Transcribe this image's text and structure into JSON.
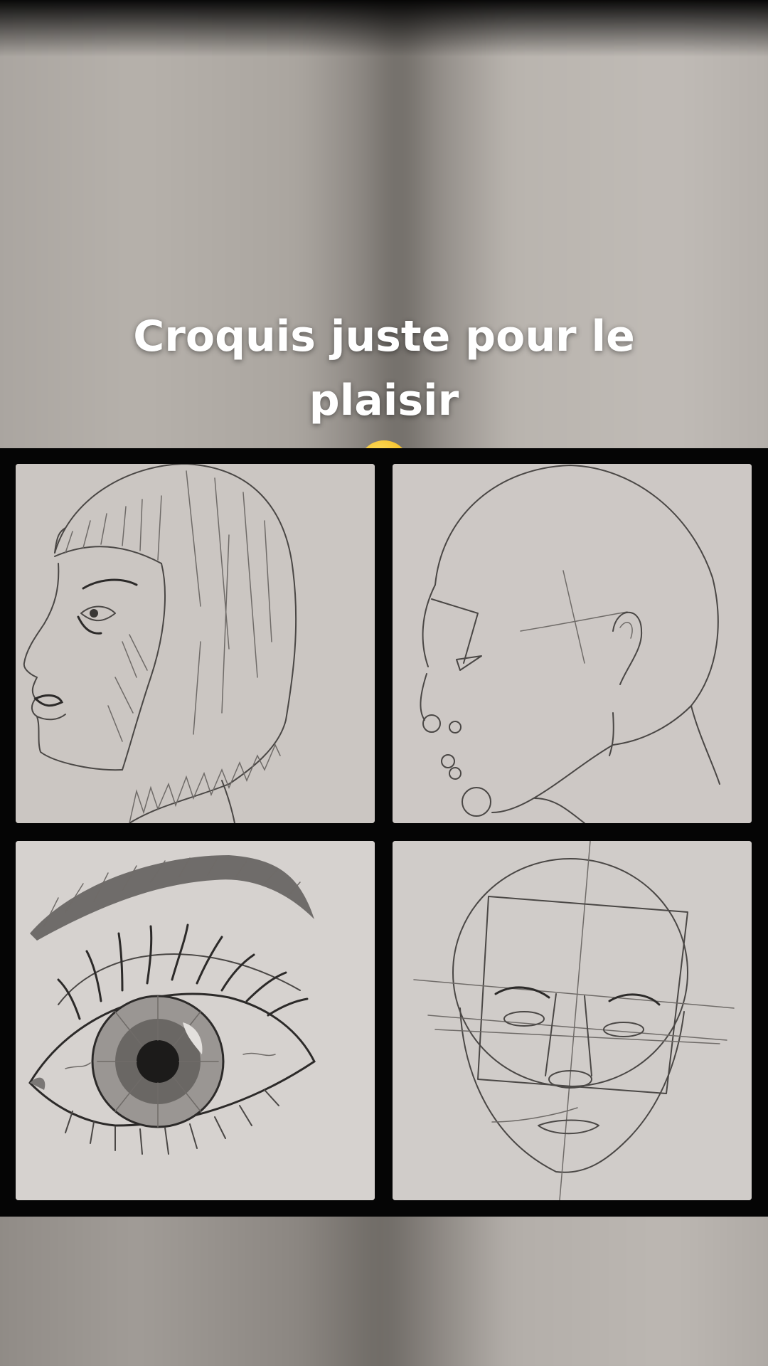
{
  "story": {
    "caption": "Croquis juste pour le plaisir",
    "caption_emoji": "winking-face-emoji"
  },
  "collage": {
    "images": [
      {
        "name": "profile-portrait-bob-hair-drawing",
        "icon": "pencil-sketch"
      },
      {
        "name": "profile-head-construction-drawing",
        "icon": "pencil-sketch"
      },
      {
        "name": "detailed-eye-drawing",
        "icon": "pencil-sketch"
      },
      {
        "name": "front-face-proportion-guide-drawing",
        "icon": "pencil-sketch"
      }
    ]
  },
  "colors": {
    "caption_text": "#ffffff",
    "collage_background": "#050505",
    "paper": "#cdc8c4",
    "emoji_face": "#f7c531"
  }
}
